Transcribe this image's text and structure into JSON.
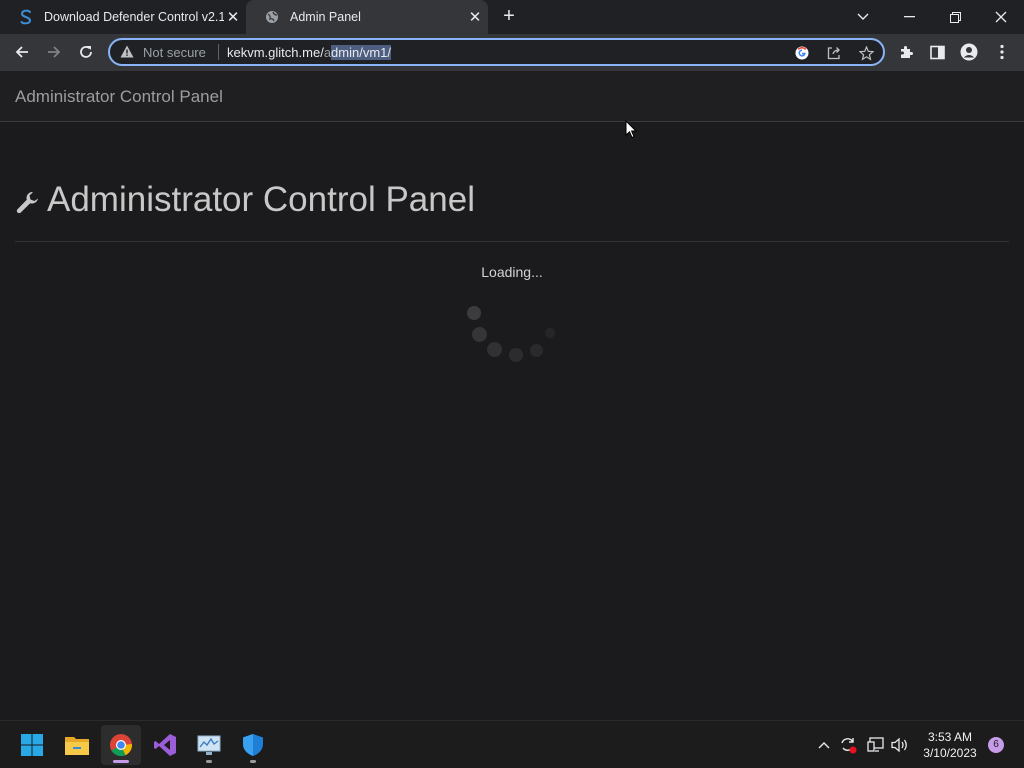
{
  "browser": {
    "tabs": [
      {
        "title": "Download Defender Control v2.1",
        "favicon": "softpedia-s-icon",
        "active": false
      },
      {
        "title": "Admin Panel",
        "favicon": "globe-icon",
        "active": true
      }
    ],
    "not_secure_label": "Not secure",
    "url_host": "kekvm.glitch.me/",
    "url_path_unselected": "a",
    "url_path_selected": "dmin/vm1/"
  },
  "page": {
    "navbar_brand": "Administrator Control Panel",
    "heading": "Administrator Control Panel",
    "heading_icon": "wrench-icon",
    "loading_text": "Loading..."
  },
  "taskbar": {
    "apps": [
      "windows-start-icon",
      "file-explorer-icon",
      "chrome-icon",
      "visual-studio-icon",
      "performance-monitor-icon",
      "windows-security-icon"
    ],
    "time": "3:53 AM",
    "date": "3/10/2023",
    "notification_count": "6"
  },
  "colors": {
    "accent": "#8ab4f8",
    "page_bg": "#1b1b1d",
    "url_selection": "#4d5e80"
  }
}
